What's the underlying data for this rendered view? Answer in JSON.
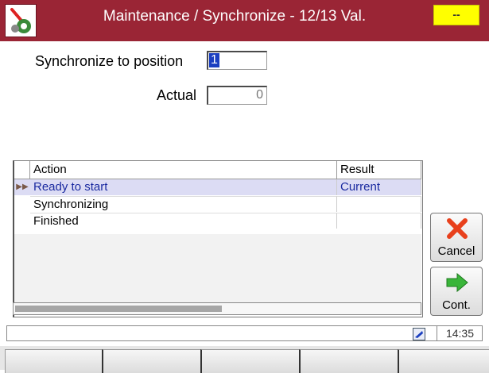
{
  "window": {
    "title": "Maintenance / Synchronize - 12/13 Val.",
    "indicator": "--",
    "app_icon": "wrench-gear-icon"
  },
  "form": {
    "sync_label": "Synchronize to position",
    "sync_value": "1",
    "actual_label": "Actual",
    "actual_value": "0"
  },
  "table": {
    "headers": [
      "Action",
      "Result"
    ],
    "rows": [
      {
        "action": "Ready to start",
        "result": "Current",
        "current": true
      },
      {
        "action": "Synchronizing",
        "result": ""
      },
      {
        "action": "Finished",
        "result": ""
      }
    ]
  },
  "buttons": {
    "cancel": "Cancel",
    "cont": "Cont."
  },
  "status": {
    "time": "14:35"
  },
  "colors": {
    "titlebar": "#9a2535",
    "indicator": "#ffff00",
    "selection": "#1b3fc0",
    "current_row": "#dcdcf4",
    "cancel_icon": "#e8401c",
    "cont_icon": "#3ab53a"
  },
  "softkeys": [
    "",
    "",
    "",
    "",
    ""
  ]
}
